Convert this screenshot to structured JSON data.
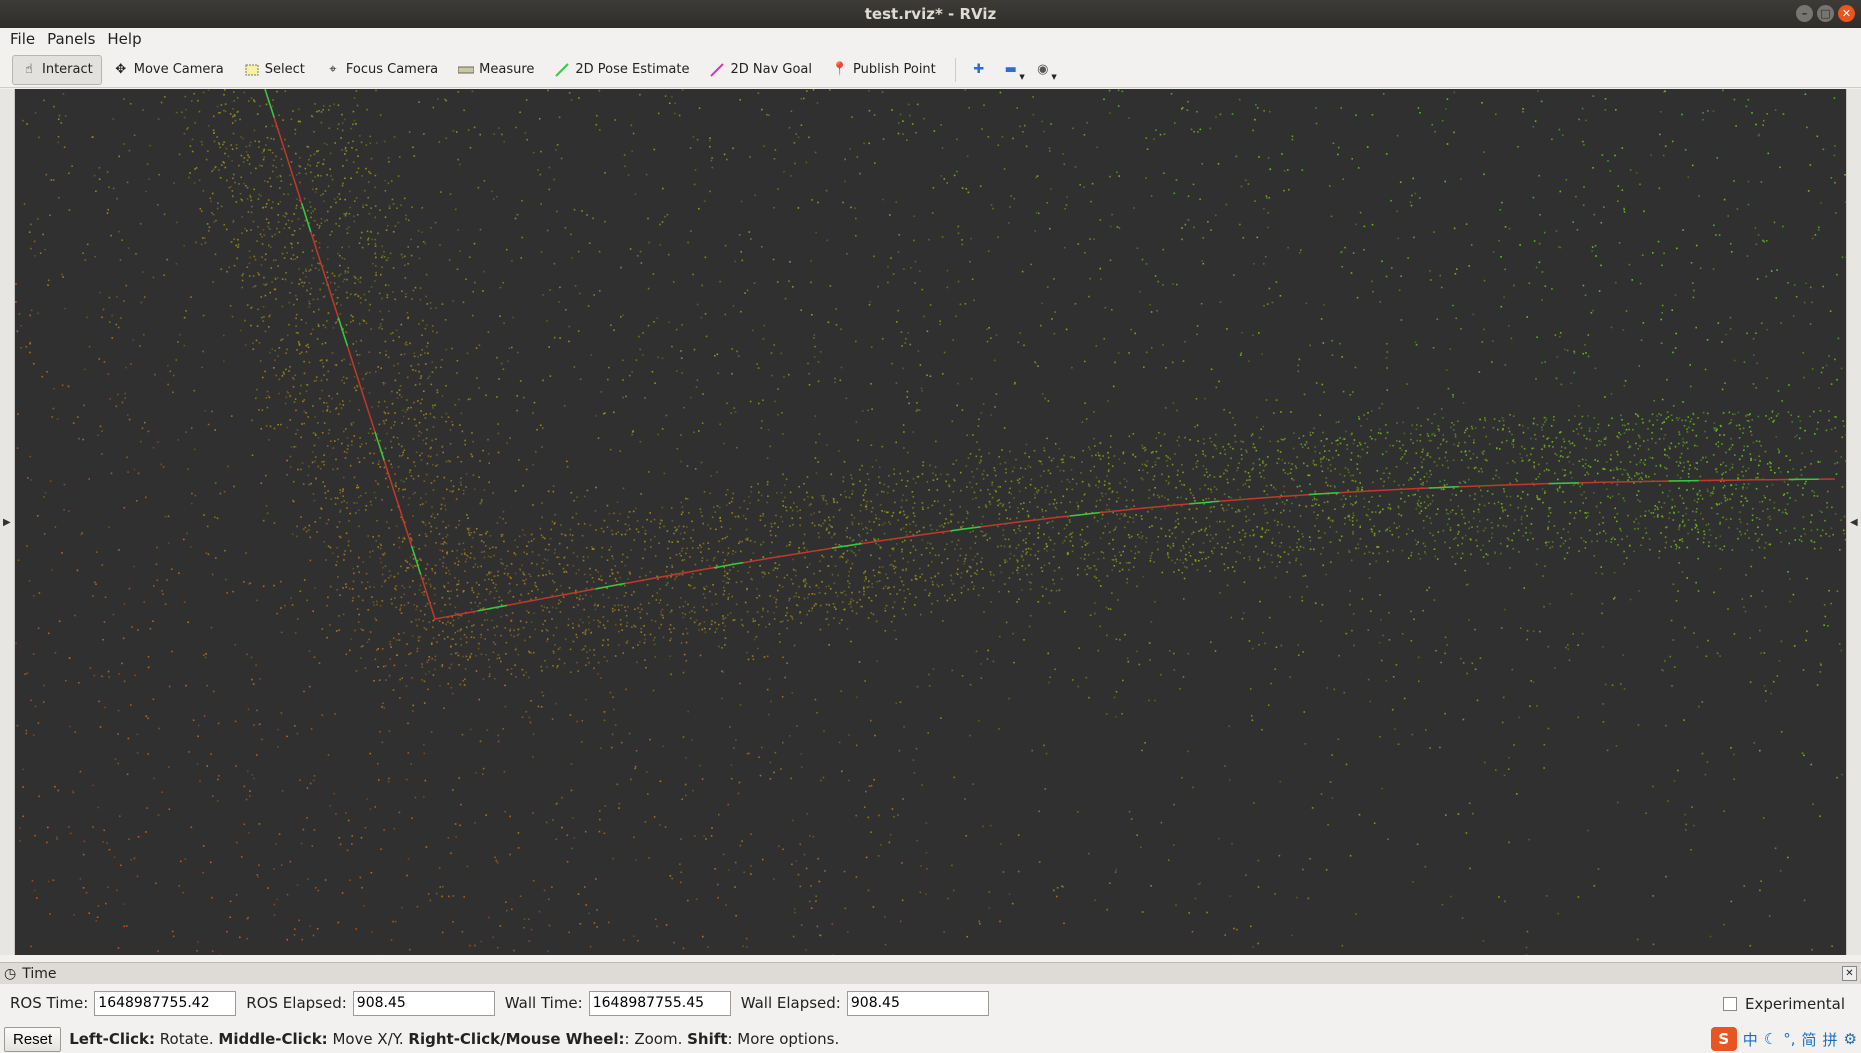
{
  "window": {
    "title": "test.rviz* - RViz"
  },
  "menu": {
    "file": "File",
    "panels": "Panels",
    "help": "Help"
  },
  "toolbar": {
    "interact": "Interact",
    "move_camera": "Move Camera",
    "select": "Select",
    "focus_camera": "Focus Camera",
    "measure": "Measure",
    "pose_estimate": "2D Pose Estimate",
    "nav_goal": "2D Nav Goal",
    "publish_point": "Publish Point"
  },
  "time_panel": {
    "title": "Time",
    "ros_time_label": "ROS Time:",
    "ros_time": "1648987755.42",
    "ros_elapsed_label": "ROS Elapsed:",
    "ros_elapsed": "908.45",
    "wall_time_label": "Wall Time:",
    "wall_time": "1648987755.45",
    "wall_elapsed_label": "Wall Elapsed:",
    "wall_elapsed": "908.45",
    "experimental_label": "Experimental"
  },
  "status": {
    "reset": "Reset",
    "left_click": "Left-Click:",
    "left_click_desc": " Rotate. ",
    "middle_click": "Middle-Click:",
    "middle_click_desc": " Move X/Y. ",
    "right_click": "Right-Click/Mouse Wheel:",
    "right_click_desc": ": Zoom. ",
    "shift": "Shift",
    "shift_desc": ": More options."
  },
  "tray": {
    "ime_char": "中",
    "simplified": "简",
    "pinyin": "拼"
  },
  "colors": {
    "viewport_bg": "#303030",
    "path_red": "#c0392b",
    "path_green": "#2ecc40"
  }
}
